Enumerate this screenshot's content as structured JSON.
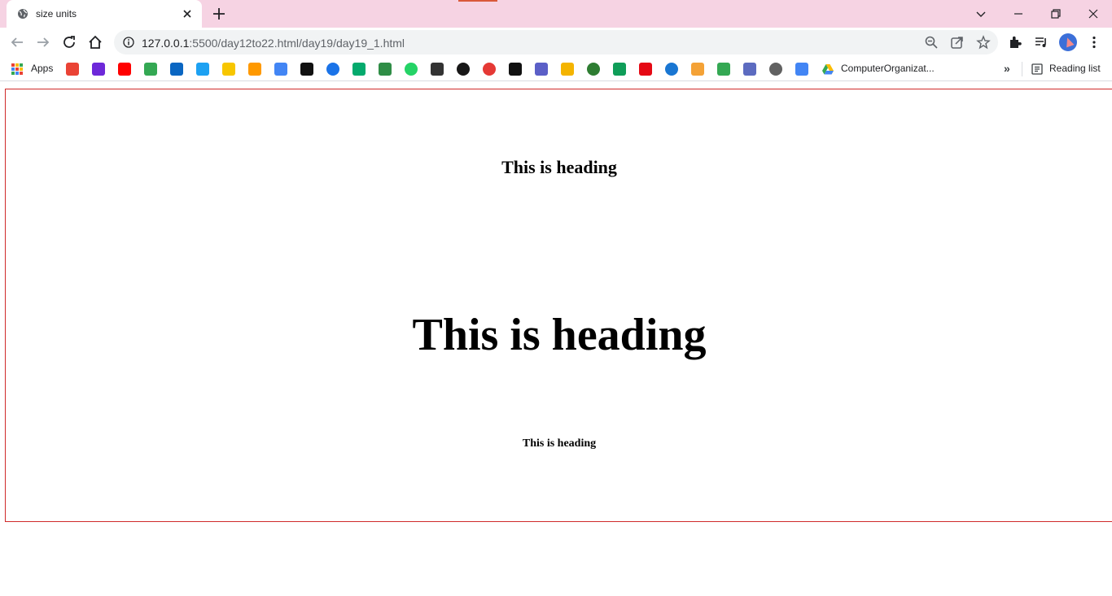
{
  "browser": {
    "tab_title": "size units",
    "url_host": "127.0.0.1",
    "url_path": ":5500/day12to22.html/day19/day19_1.html"
  },
  "bookmarks": {
    "apps_label": "Apps",
    "icons": [
      "gmail-icon",
      "mail-icon",
      "youtube-icon",
      "maps-icon",
      "linkedin-icon",
      "twitter-icon",
      "flipkart-icon",
      "amazon-icon",
      "google-icon",
      "calendar-icon",
      "chrome-c-icon",
      "w3-icon",
      "geeksforgeeks-icon",
      "whatsapp-icon",
      "graduation-cap-icon",
      "github-icon",
      "dashed-circle-icon",
      "hacker-icon",
      "code-icon",
      "classroom-icon",
      "green-circle-icon",
      "sheets-icon",
      "netflix-icon",
      "play-icon",
      "brackets-icon",
      "drive-icon",
      "list-icon",
      "shield-icon",
      "google-g-icon"
    ],
    "icon_colors": [
      "#ea4335",
      "#6d28d9",
      "#ff0000",
      "#34a853",
      "#0a66c2",
      "#1da1f2",
      "#f7c600",
      "#ff9900",
      "#4285f4",
      "#111111",
      "#1a73e8",
      "#04aa6d",
      "#2f8d46",
      "#25d366",
      "#333333",
      "#181717",
      "#e53935",
      "#111111",
      "#5b5fc7",
      "#f4b400",
      "#2e7d32",
      "#0f9d58",
      "#e50914",
      "#1976d2",
      "#f4a236",
      "#34a853",
      "#5c6bc0",
      "#616161",
      "#4285f4"
    ],
    "last_label": "ComputerOrganizat...",
    "reading_list_label": "Reading list"
  },
  "page": {
    "heading_1": "This is heading",
    "heading_2": "This is heading",
    "heading_3": "This is heading"
  }
}
